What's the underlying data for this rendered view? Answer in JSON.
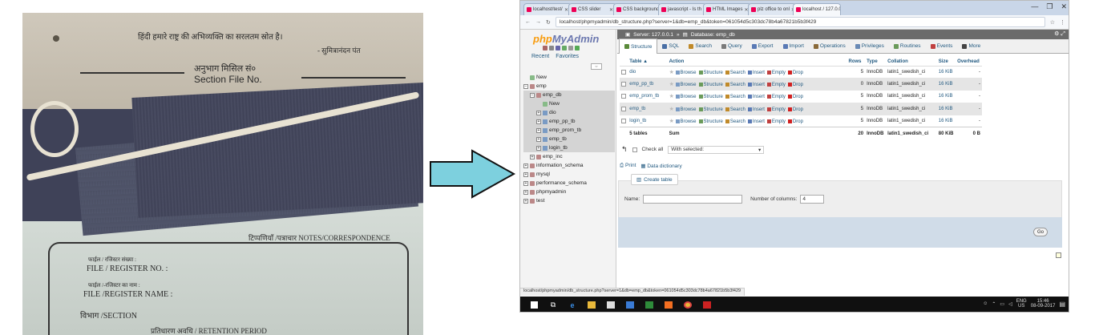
{
  "photo": {
    "hindi_top": "हिंदी हमारे राष्ट्र की अभिव्यक्ति का सरलतम स्रोत है।",
    "hindi_author": "- सुमित्रानंदन पंत",
    "section_file_hindi": "अनुभाग मिसिल सं०",
    "section_file_en": "Section File No.",
    "notes_label": "टिप्पणियाँ /पत्राचार NOTES/CORRESPONDENCE",
    "file_register_hi": "फाईल / रजिस्टर संख्या :",
    "file_register_no": "FILE / REGISTER NO. :",
    "file_register_name_hi": "फाईल /-रजिस्टर का नाम :",
    "file_register_name": "FILE /REGISTER NAME :",
    "section_hi": "विभाग /",
    "section": "SECTION",
    "retention": "प्रतिधारण अवधि / RETENTION PERIOD"
  },
  "browser": {
    "tabs": [
      {
        "label": "localhost/test/"
      },
      {
        "label": "CSS slider"
      },
      {
        "label": "CSS backgrounds"
      },
      {
        "label": "javascript - Is th"
      },
      {
        "label": "HTML Images"
      },
      {
        "label": "plz office to onl"
      },
      {
        "label": "localhost / 127.0.0"
      }
    ],
    "url": "localhost/phpmyadmin/db_structure.php?server=1&db=emp_db&token=061054d5c303dc78b4a67821b5b3f429",
    "win_minimize": "—",
    "win_maximize": "❐",
    "win_close": "✕"
  },
  "nav": {
    "logo_php": "php",
    "logo_myadmin": "MyAdmin",
    "recent": "Recent",
    "favorites": "Favorites",
    "collapse": "⇔",
    "tree": [
      {
        "label": "New",
        "indent": 0,
        "type": "new"
      },
      {
        "label": "emp",
        "indent": 0,
        "type": "db",
        "pm": "−"
      },
      {
        "label": "emp_db",
        "indent": 1,
        "type": "db",
        "pm": "−",
        "sel": true
      },
      {
        "label": "New",
        "indent": 2,
        "type": "new",
        "sel": true
      },
      {
        "label": "dio",
        "indent": 2,
        "type": "tbl",
        "pm": "+",
        "sel": true
      },
      {
        "label": "emp_pp_tb",
        "indent": 2,
        "type": "tbl",
        "pm": "+",
        "sel": true
      },
      {
        "label": "emp_prom_tb",
        "indent": 2,
        "type": "tbl",
        "pm": "+",
        "sel": true
      },
      {
        "label": "emp_tb",
        "indent": 2,
        "type": "tbl",
        "pm": "+",
        "sel": true
      },
      {
        "label": "login_tb",
        "indent": 2,
        "type": "tbl",
        "pm": "+",
        "sel": true
      },
      {
        "label": "emp_inc",
        "indent": 1,
        "type": "db",
        "pm": "+"
      },
      {
        "label": "information_schema",
        "indent": 0,
        "type": "db",
        "pm": "+"
      },
      {
        "label": "mysql",
        "indent": 0,
        "type": "db",
        "pm": "+"
      },
      {
        "label": "performance_schema",
        "indent": 0,
        "type": "db",
        "pm": "+"
      },
      {
        "label": "phpmyadmin",
        "indent": 0,
        "type": "db",
        "pm": "+"
      },
      {
        "label": "test",
        "indent": 0,
        "type": "db",
        "pm": "+"
      }
    ]
  },
  "main": {
    "server": "Server: 127.0.0.1",
    "arrow": "»",
    "database": "Database: emp_db",
    "menu": [
      {
        "label": "Structure",
        "color": "#5a8a3a"
      },
      {
        "label": "SQL",
        "color": "#4a6fa5"
      },
      {
        "label": "Search",
        "color": "#c08a2a"
      },
      {
        "label": "Query",
        "color": "#7a7a7a"
      },
      {
        "label": "Export",
        "color": "#5a7ab5"
      },
      {
        "label": "Import",
        "color": "#5a7ab5"
      },
      {
        "label": "Operations",
        "color": "#8a6a3a"
      },
      {
        "label": "Privileges",
        "color": "#6a8ab5"
      },
      {
        "label": "Routines",
        "color": "#6a9a5a"
      },
      {
        "label": "Events",
        "color": "#c04040"
      },
      {
        "label": "More",
        "color": "#444444"
      }
    ],
    "headers": {
      "table": "Table",
      "action": "Action",
      "rows": "Rows",
      "type": "Type",
      "collation": "Collation",
      "size": "Size",
      "overhead": "Overhead"
    },
    "actions": [
      "Browse",
      "Structure",
      "Search",
      "Insert",
      "Empty",
      "Drop"
    ],
    "rows": [
      {
        "name": "dio",
        "rows": "5",
        "type": "InnoDB",
        "collation": "latin1_swedish_ci",
        "size": "16 KiB",
        "overhead": "-"
      },
      {
        "name": "emp_pp_tb",
        "rows": "0",
        "type": "InnoDB",
        "collation": "latin1_swedish_ci",
        "size": "16 KiB",
        "overhead": "-"
      },
      {
        "name": "emp_prom_tb",
        "rows": "5",
        "type": "InnoDB",
        "collation": "latin1_swedish_ci",
        "size": "16 KiB",
        "overhead": "-"
      },
      {
        "name": "emp_tb",
        "rows": "5",
        "type": "InnoDB",
        "collation": "latin1_swedish_ci",
        "size": "16 KiB",
        "overhead": "-"
      },
      {
        "name": "login_tb",
        "rows": "5",
        "type": "InnoDB",
        "collation": "latin1_swedish_ci",
        "size": "16 KiB",
        "overhead": "-"
      }
    ],
    "footer": {
      "tables": "5 tables",
      "sum": "Sum",
      "rows": "20",
      "type": "InnoDB",
      "collation": "latin1_swedish_ci",
      "size": "80 KiB",
      "overhead": "0 B"
    },
    "check_all": "Check all",
    "with_selected": "With selected:",
    "print": "Print",
    "data_dictionary": "Data dictionary",
    "create_table": "Create table",
    "name_label": "Name:",
    "num_columns_label": "Number of columns:",
    "num_columns_value": "4",
    "go": "Go"
  },
  "status_url": "localhost/phpmyadmin/db_structure.php?server=1&db=emp_db&token=061054d5c303dc78b4a67821b5b3f429",
  "taskbar": {
    "lang": "ENG",
    "region": "US",
    "time": "15:46",
    "date": "08-09-2017"
  }
}
